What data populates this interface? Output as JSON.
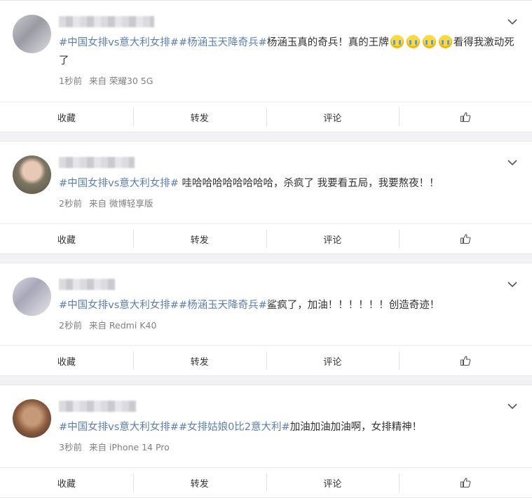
{
  "posts": [
    {
      "segments": [
        {
          "type": "tag",
          "text": "#中国女排vs意大利女排#"
        },
        {
          "type": "tag",
          "text": "#杨涵玉天降奇兵#"
        },
        {
          "type": "text",
          "text": "杨涵玉真的奇兵！真的王牌"
        },
        {
          "type": "emoji",
          "name": "crying-emoji"
        },
        {
          "type": "emoji",
          "name": "crying-emoji"
        },
        {
          "type": "emoji",
          "name": "crying-emoji"
        },
        {
          "type": "emoji",
          "name": "crying-emoji"
        },
        {
          "type": "text",
          "text": "看得我激动死了"
        }
      ],
      "time": "1秒前",
      "source": "来自 荣耀30 5G"
    },
    {
      "segments": [
        {
          "type": "tag",
          "text": "#中国女排vs意大利女排#"
        },
        {
          "type": "text",
          "text": " 哇哈哈哈哈哈哈哈哈，杀疯了 我要看五局，我要熬夜！！"
        }
      ],
      "time": "2秒前",
      "source": "来自 微博轻享版"
    },
    {
      "segments": [
        {
          "type": "tag",
          "text": "#中国女排vs意大利女排#"
        },
        {
          "type": "tag",
          "text": "#杨涵玉天降奇兵#"
        },
        {
          "type": "text",
          "text": "鲨疯了，加油！！！！！！创造奇迹！"
        }
      ],
      "time": "2秒前",
      "source": "来自 Redmi K40"
    },
    {
      "segments": [
        {
          "type": "tag",
          "text": "#中国女排vs意大利女排#"
        },
        {
          "type": "tag",
          "text": "#女排姑娘0比2意大利#"
        },
        {
          "type": "text",
          "text": "加油加油加油啊，女排精神！"
        }
      ],
      "time": "3秒前",
      "source": "来自 iPhone 14 Pro"
    }
  ],
  "actions": {
    "favorite": "收藏",
    "repost": "转发",
    "comment": "评论",
    "like_icon": "thumbs-up-icon"
  },
  "colors": {
    "hashtag": "#5c7fb3",
    "meta": "#808080",
    "background": "#f2f2f5"
  }
}
